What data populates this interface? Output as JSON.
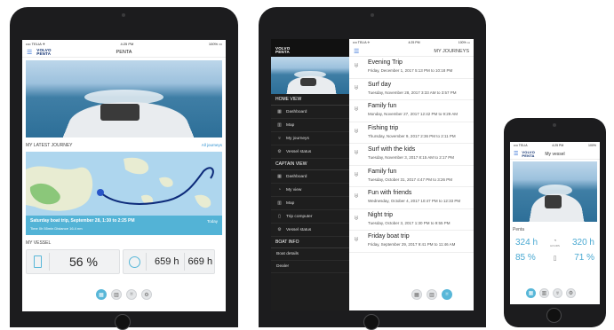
{
  "ipad1": {
    "status": {
      "carrier": "•••• TELIA ✈",
      "time": "4:25 PM",
      "battery": "100% ▭"
    },
    "nav_title": "PENTA",
    "logo": "VOLVO PENTA",
    "latest_journey": {
      "title": "MY LATEST JOURNEY",
      "link": "All journeys",
      "trip_title": "Saturday boat trip, September 28, 1:30 to 2:25 PM",
      "trip_meta": "Time 0h 55min    Distance 16.4 nm",
      "badge": "Today"
    },
    "my_vessel": {
      "title": "MY VESSEL",
      "fuel": "56 %",
      "engine1_hours": "659 h",
      "engine2_hours": "669 h"
    }
  },
  "ipad2": {
    "status": {
      "carrier": "•••• TELIA ✈",
      "time": "4:25 PM",
      "battery": "100% ▭"
    },
    "logo": "VOLVO PENTA",
    "nav_title": "MY JOURNEYS",
    "menu": [
      {
        "type": "header",
        "label": "HOME VIEW"
      },
      {
        "type": "item",
        "icon": "dashboard-icon",
        "glyph": "▦",
        "label": "Dashboard"
      },
      {
        "type": "item",
        "icon": "map-icon",
        "glyph": "▥",
        "label": "Map"
      },
      {
        "type": "item",
        "icon": "journeys-icon",
        "glyph": "♅",
        "label": "My journeys"
      },
      {
        "type": "item",
        "icon": "vessel-status-icon",
        "glyph": "⚙",
        "label": "Vessel status"
      },
      {
        "type": "header",
        "label": "CAPTAIN VIEW"
      },
      {
        "type": "item",
        "icon": "dashboard-icon",
        "glyph": "▦",
        "label": "Dashboard"
      },
      {
        "type": "item",
        "icon": "my-view-icon",
        "glyph": "◔",
        "label": "My view"
      },
      {
        "type": "item",
        "icon": "map-icon",
        "glyph": "▥",
        "label": "Map"
      },
      {
        "type": "item",
        "icon": "trip-computer-icon",
        "glyph": "▯",
        "label": "Trip computer"
      },
      {
        "type": "item",
        "icon": "vessel-status-icon",
        "glyph": "⚙",
        "label": "Vessel status"
      },
      {
        "type": "header",
        "label": "BOAT INFO"
      },
      {
        "type": "item",
        "icon": "",
        "glyph": "",
        "label": "Boat details"
      },
      {
        "type": "item",
        "icon": "",
        "glyph": "",
        "label": "Dealer"
      }
    ],
    "journeys": [
      {
        "title": "Evening Trip",
        "date": "Friday, December 1, 2017 5:13 PM to 10:18 PM"
      },
      {
        "title": "Surf day",
        "date": "Tuesday, November 28, 2017 3:33 AM to 3:57 PM"
      },
      {
        "title": "Family fun",
        "date": "Monday, November 27, 2017 12:42 PM to 9:29 AM"
      },
      {
        "title": "Fishing trip",
        "date": "Thursday, November 9, 2017 2:36 PM to 2:11 PM"
      },
      {
        "title": "Surf with the kids",
        "date": "Tuesday, November 3, 2017 8:15 AM to 2:17 PM"
      },
      {
        "title": "Family fun",
        "date": "Tuesday, October 31, 2017 4:47 PM to 3:26 PM"
      },
      {
        "title": "Fun with friends",
        "date": "Wednesday, October 4, 2017 10:47 PM to 12:33 PM"
      },
      {
        "title": "Night trip",
        "date": "Tuesday, October 3, 2017 1:30 PM to 9:55 PM"
      },
      {
        "title": "Friday boat trip",
        "date": "Friday, September 29, 2017 9:41 PM to 11:46 AM"
      }
    ]
  },
  "iphone": {
    "status": {
      "carrier": "•••• TELIA",
      "time": "4:25 PM",
      "battery": "100%"
    },
    "logo": "VOLVO PENTA",
    "nav_title": "My vessel",
    "label": "Penta",
    "left_hours": "324 h",
    "right_hours": "320 h",
    "left_fuel": "85 %",
    "right_fuel": "71 %",
    "center_label": "HOURS"
  }
}
